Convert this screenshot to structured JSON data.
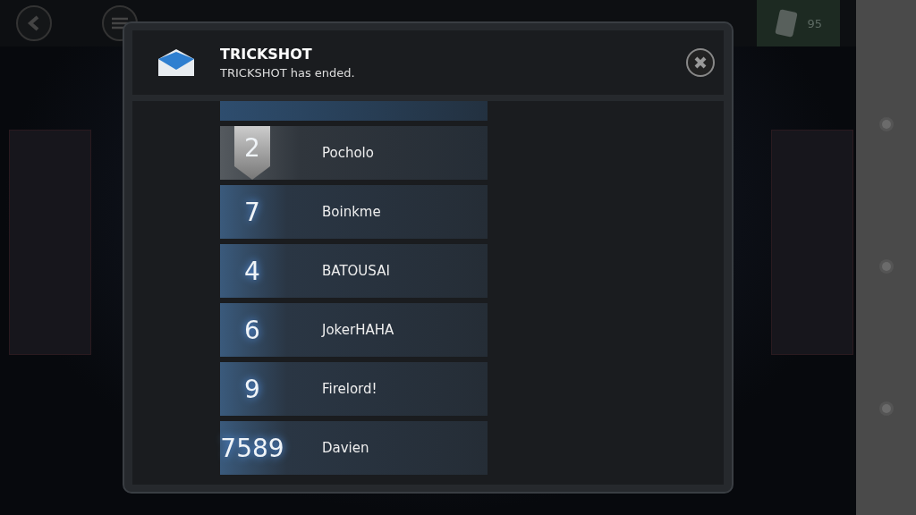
{
  "top_bar": {
    "currency": "95"
  },
  "dialog": {
    "title": "TRICKSHOT",
    "message": "TRICKSHOT has ended."
  },
  "leaderboard": {
    "rows": [
      {
        "kind": "cut",
        "rank": "",
        "name": ""
      },
      {
        "kind": "medal",
        "rank": "2",
        "name": "Pocholo"
      },
      {
        "kind": "plain",
        "rank": "7",
        "name": "Boinkme"
      },
      {
        "kind": "plain",
        "rank": "4",
        "name": "BATOUSAI"
      },
      {
        "kind": "plain",
        "rank": "6",
        "name": "JokerHAHA"
      },
      {
        "kind": "plain",
        "rank": "9",
        "name": "Firelord!"
      },
      {
        "kind": "plain",
        "rank": "7589",
        "name": "Davien"
      }
    ]
  }
}
